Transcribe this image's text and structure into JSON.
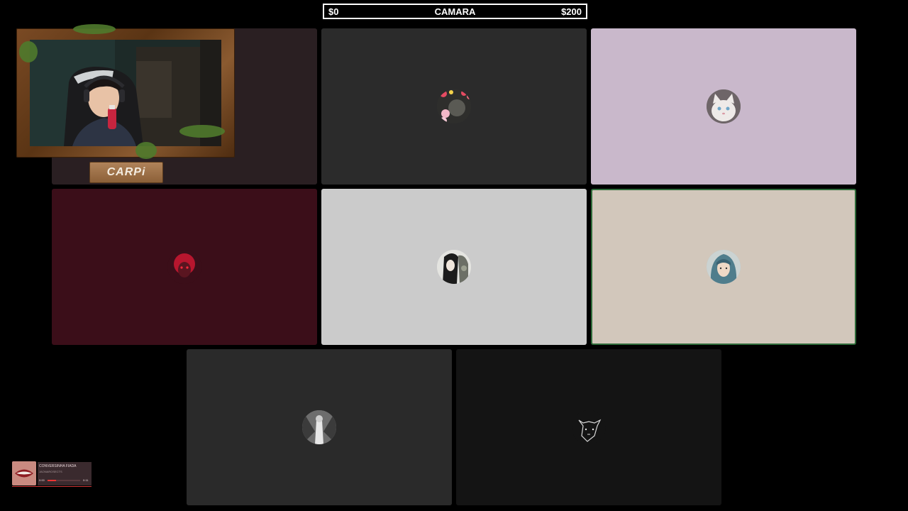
{
  "goal": {
    "left": "$0",
    "title": "CAMARA",
    "right": "$200"
  },
  "streamer": {
    "name": "CARPi"
  },
  "tiles": [
    {
      "id": "tile-1",
      "bg": "#2a1f22",
      "avatar": "none"
    },
    {
      "id": "tile-2",
      "bg": "#2b2b2b",
      "avatar": "flower-girl"
    },
    {
      "id": "tile-3",
      "bg": "#c9b8cb",
      "avatar": "white-cat"
    },
    {
      "id": "tile-4",
      "bg": "#3b0e19",
      "avatar": "red-hair-girl"
    },
    {
      "id": "tile-5",
      "bg": "#cbcbcb",
      "avatar": "dark-hair-person"
    },
    {
      "id": "tile-6",
      "bg": "#d2c7bb",
      "avatar": "teal-hair-girl",
      "speaking": true
    },
    {
      "id": "tile-7",
      "bg": "#2a2a2a",
      "avatar": "greyscale-figure"
    },
    {
      "id": "tile-8",
      "bg": "#141414",
      "avatar": "wolf-sketch"
    }
  ],
  "now_playing": {
    "title": "CONVERSINHA FIADA",
    "artist": "JAONAROSECTS",
    "elapsed": "0:00",
    "duration": "0:11",
    "progress": 0.25
  },
  "colors": {
    "speaking_border": "#2f6b3a",
    "progress": "#ee3333"
  }
}
